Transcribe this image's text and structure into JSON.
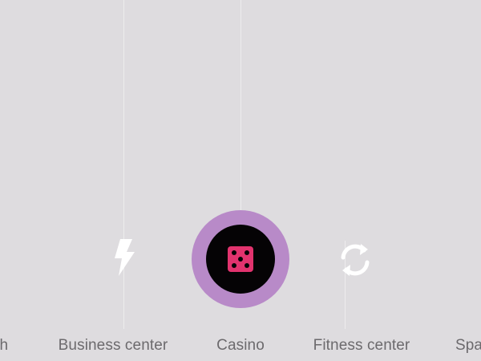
{
  "carousel": {
    "items": [
      {
        "label": "ch",
        "icon": "partial-item"
      },
      {
        "label": "Business center",
        "icon": "flash-icon"
      },
      {
        "label": "Casino",
        "icon": "dice-icon",
        "selected": true
      },
      {
        "label": "Fitness center",
        "icon": "refresh-icon"
      },
      {
        "label": "Spa",
        "icon": "partial-item"
      }
    ]
  },
  "colors": {
    "background": "#dedcdf",
    "label": "#6c6a6d",
    "selected_ring": "#b88ac8",
    "selected_core": "#050305",
    "dice": "#e2336e",
    "icon_white": "#ffffff"
  }
}
